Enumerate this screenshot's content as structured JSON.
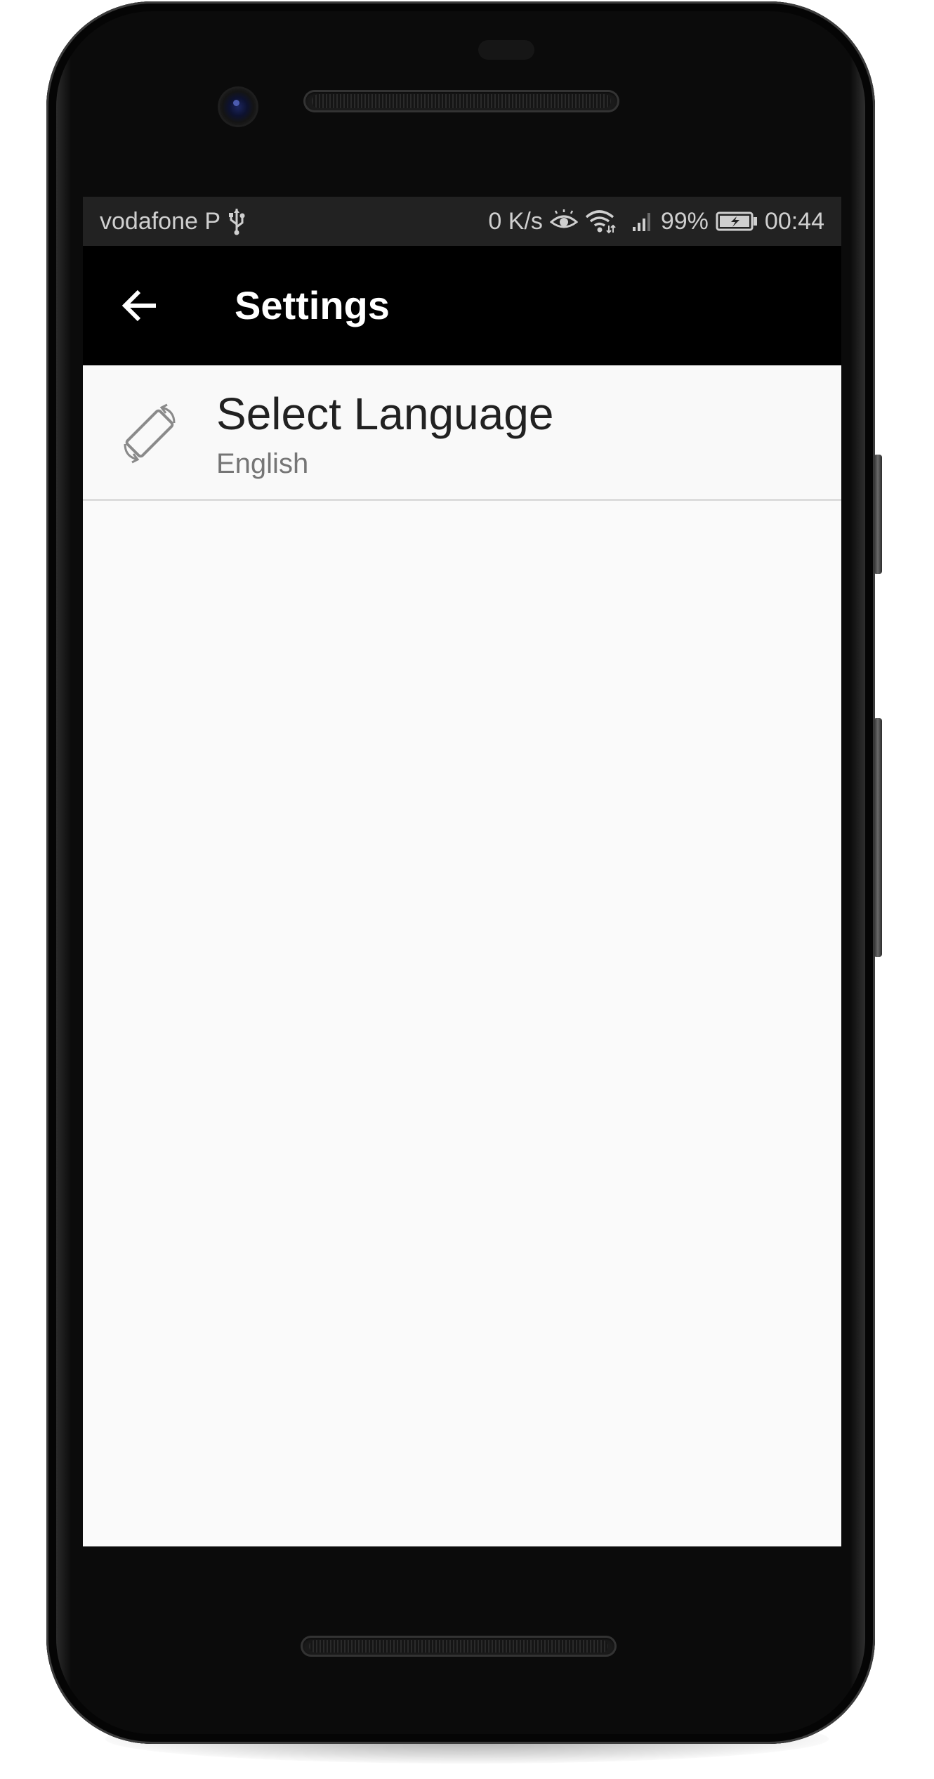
{
  "status_bar": {
    "carrier": "vodafone P",
    "net_speed": "0 K/s",
    "battery_percent": "99%",
    "time": "00:44",
    "icons": [
      "usb-icon",
      "eye-icon",
      "wifi-icon",
      "signal-icon",
      "battery-charging-icon"
    ]
  },
  "toolbar": {
    "back_icon": "arrow-left-icon",
    "title": "Settings"
  },
  "preferences": [
    {
      "icon": "screen-rotation-icon",
      "title": "Select Language",
      "summary": "English"
    }
  ],
  "colors": {
    "status_bar_bg": "#222222",
    "toolbar_bg": "#000000",
    "screen_bg": "#fafafa",
    "title_text": "#212121",
    "summary_text": "#757575"
  }
}
